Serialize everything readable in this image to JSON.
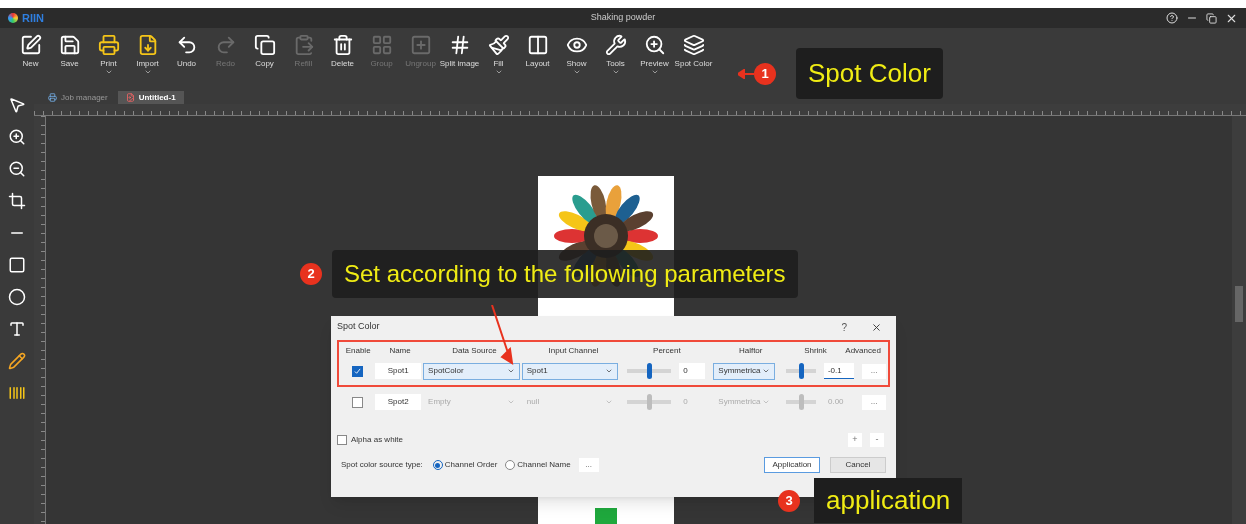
{
  "window": {
    "logo": "RIIN",
    "title": "Shaking powder"
  },
  "toolbar": [
    {
      "label": "New",
      "disabled": false,
      "dropdown": false
    },
    {
      "label": "Save",
      "disabled": false,
      "dropdown": false
    },
    {
      "label": "Print",
      "disabled": false,
      "dropdown": true
    },
    {
      "label": "Import",
      "disabled": false,
      "dropdown": true
    },
    {
      "label": "Undo",
      "disabled": false,
      "dropdown": false
    },
    {
      "label": "Redo",
      "disabled": true,
      "dropdown": false
    },
    {
      "label": "Copy",
      "disabled": false,
      "dropdown": false
    },
    {
      "label": "Refill",
      "disabled": true,
      "dropdown": false
    },
    {
      "label": "Delete",
      "disabled": false,
      "dropdown": false
    },
    {
      "label": "Group",
      "disabled": true,
      "dropdown": false
    },
    {
      "label": "Ungroup",
      "disabled": true,
      "dropdown": false
    },
    {
      "label": "Split image",
      "disabled": false,
      "dropdown": false
    },
    {
      "label": "Fill",
      "disabled": false,
      "dropdown": true
    },
    {
      "label": "Layout",
      "disabled": false,
      "dropdown": false
    },
    {
      "label": "Show",
      "disabled": false,
      "dropdown": true
    },
    {
      "label": "Tools",
      "disabled": false,
      "dropdown": true
    },
    {
      "label": "Preview",
      "disabled": false,
      "dropdown": true
    },
    {
      "label": "Spot Color",
      "disabled": false,
      "dropdown": false
    }
  ],
  "tabs": [
    {
      "label": "Job manager",
      "selected": false
    },
    {
      "label": "Untitled-1",
      "selected": true
    }
  ],
  "callouts": [
    {
      "number": "1",
      "text": "Spot Color"
    },
    {
      "number": "2",
      "text": "Set according to the following parameters"
    },
    {
      "number": "3",
      "text": "application"
    }
  ],
  "dialog": {
    "title": "Spot Color",
    "help": "?",
    "columns": [
      "Enable",
      "Name",
      "Data Source",
      "Input Channel",
      "Percent",
      "Halftor",
      "Shrink",
      "Advanced"
    ],
    "rows": [
      {
        "checked": true,
        "name": "Spot1",
        "data_source": "SpotColor",
        "input_channel": "Spot1",
        "percent": {
          "level": 0.5,
          "value": "0"
        },
        "halftone": "Symmetrica",
        "shrink": {
          "level": 0.5,
          "value": "-0.1"
        },
        "advanced": "..."
      },
      {
        "checked": false,
        "name": "Spot2",
        "data_source": "Empty",
        "input_channel": "null",
        "percent": {
          "level": 0.5,
          "value": "0"
        },
        "halftone": "Symmetrica",
        "shrink": {
          "level": 0.5,
          "value": "0.00"
        },
        "advanced": "..."
      }
    ],
    "alpha_as_white": {
      "label": "Alpha as white",
      "checked": false
    },
    "add_button": "+",
    "remove_button": "-",
    "source_type": {
      "label": "Spot color source type:",
      "options": [
        {
          "label": "Channel Order",
          "selected": true
        },
        {
          "label": "Channel Name",
          "selected": false
        }
      ],
      "more": "..."
    },
    "buttons": [
      "Application",
      "Cancel"
    ]
  }
}
